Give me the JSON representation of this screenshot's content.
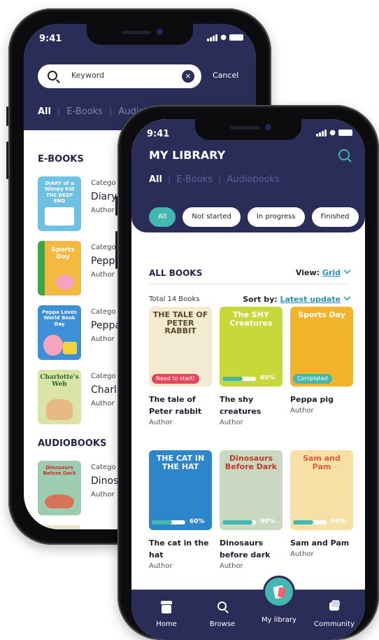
{
  "status": {
    "time": "9:41"
  },
  "search_screen": {
    "search": {
      "value": "Keyword"
    },
    "cancel": "Cancel",
    "tabs": [
      "All",
      "E-Books",
      "Audiobooks"
    ],
    "ebooks_heading": "E-BOOKS",
    "audiobooks_heading": "AUDIOBOOKS",
    "ebooks": [
      {
        "category": "Catego",
        "title": "Diary",
        "author": "Author",
        "cover": {
          "text": "DIARY of a Wimpy Kid THE DEEP END",
          "color": "#6ec1e4"
        }
      },
      {
        "category": "Catego",
        "title": "Peppa",
        "author": "Author",
        "cover": {
          "text": "Sports Day",
          "color": "#f4b940"
        }
      },
      {
        "category": "Catego",
        "title": "Peppa",
        "author": "Author",
        "cover": {
          "text": "Peppa Loves World Book Day",
          "color": "#3d8fd8"
        }
      },
      {
        "category": "Catego",
        "title": "Charl",
        "author": "Author",
        "cover": {
          "text": "Charlotte's Web",
          "color": "#d9e4a6"
        }
      }
    ],
    "audiobooks": [
      {
        "category": "Catego",
        "title": "Dinos",
        "author": "Author",
        "cover": {
          "text": "Dinosaurs Before Dark",
          "color": "#9ccdb0"
        }
      }
    ]
  },
  "library_screen": {
    "title": "MY LIBRARY",
    "tabs": [
      "All",
      "E-Books",
      "Audiobooks"
    ],
    "chips": [
      "All",
      "Not started",
      "In progress",
      "Finished"
    ],
    "all_books": "ALL BOOKS",
    "view_label": "View:",
    "view_value": "Grid",
    "total": "Total 14 Books",
    "sort_label": "Sort by:",
    "sort_value": "Latest update",
    "books": [
      {
        "title": "The tale of Peter rabbit",
        "author": "Author",
        "cover_text": "THE TALE OF PETER RABBIT",
        "cover_color": "#f3ead2",
        "text_color": "#5b4a2a",
        "tag": "Need to start!",
        "tag_color": "#e8455c"
      },
      {
        "title": "The shy creatures",
        "author": "Author",
        "cover_text": "The SHY Creatures",
        "cover_color": "#c8d83a",
        "text_color": "#ffffff",
        "progress": 0.6,
        "progress_label": "60%"
      },
      {
        "title": "Peppa pig",
        "author": "Author",
        "cover_text": "Sports Day",
        "cover_color": "#f3b32b",
        "text_color": "#ffffff",
        "tag": "Completed",
        "tag_color": "#43b7b0"
      },
      {
        "title": "The cat in the hat",
        "author": "Author",
        "cover_text": "THE CAT IN THE HAT",
        "cover_color": "#2c86c9",
        "text_color": "#ffffff",
        "progress": 0.6,
        "progress_label": "60%"
      },
      {
        "title": "Dinosaurs before dark",
        "author": "Author",
        "cover_text": "Dinosaurs Before Dark",
        "cover_color": "#c9d8c0",
        "text_color": "#c0392b",
        "progress": 0.9,
        "progress_label": "90%"
      },
      {
        "title": "Sam and Pam",
        "author": "Author",
        "cover_text": "Sam and Pam",
        "cover_color": "#f6e0a6",
        "text_color": "#e05a3a",
        "progress": 0.6,
        "progress_label": "60%"
      }
    ],
    "nav": [
      {
        "label": "Home",
        "icon": "home-icon"
      },
      {
        "label": "Browse",
        "icon": "search-icon"
      },
      {
        "label": "My library",
        "icon": "library-icon"
      },
      {
        "label": "Community",
        "icon": "chat-icon"
      }
    ]
  },
  "colors": {
    "primary": "#2a2d58",
    "accent": "#43b7b0",
    "fab": "#f2b82a"
  }
}
